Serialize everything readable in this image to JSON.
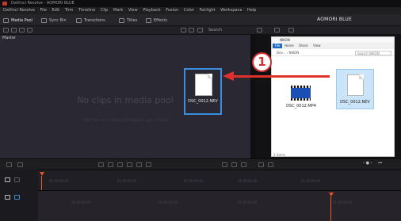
{
  "window": {
    "title": "DaVinci Resolve - AOMORI BLUE"
  },
  "menu": [
    "DaVinci Resolve",
    "File",
    "Edit",
    "Trim",
    "Timeline",
    "Clip",
    "Mark",
    "View",
    "Playback",
    "Fusion",
    "Color",
    "Fairlight",
    "Workspace",
    "Help"
  ],
  "toolbar": {
    "media_pool": "Media Pool",
    "sync_bin": "Sync Bin",
    "transitions": "Transitions",
    "titles": "Titles",
    "effects": "Effects",
    "project_title": "AOMORI BLUE"
  },
  "media_pool": {
    "bin_label": "Master",
    "search_label": "Search",
    "empty_title": "No clips in media pool",
    "empty_hint": "Add clips from Media Storage to get started",
    "dragged_clip_name": "DSC_0012.NEV"
  },
  "explorer": {
    "title": "NIKON",
    "tabs": [
      "File",
      "Home",
      "Share",
      "View"
    ],
    "address": "Dev... › NIKON",
    "search_placeholder": "Search NIKON",
    "files": [
      {
        "name": "DSC_0012.MP4",
        "type": "video"
      },
      {
        "name": "DSC_0012.NEV",
        "type": "document",
        "selected": true
      }
    ],
    "status": "2 items"
  },
  "annotation": {
    "step_number": "1",
    "arrow_color": "#e0302c"
  },
  "timeline": {
    "timecode_marks": [
      "01:00:00:00",
      "01:00:02:00",
      "01:00:04:00",
      "01:00:06:00",
      "01:00:08:00"
    ]
  },
  "colors": {
    "accent": "#3a8fdc",
    "playhead": "#e8502a",
    "annotation": "#d32f2f"
  }
}
